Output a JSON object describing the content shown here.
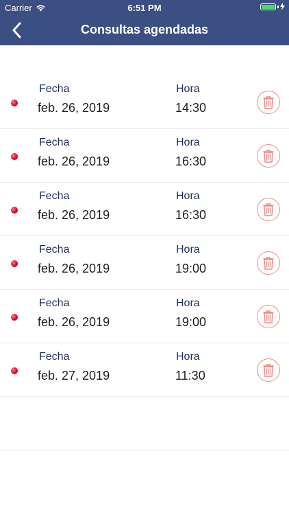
{
  "status_bar": {
    "carrier": "Carrier",
    "time": "6:51 PM"
  },
  "nav": {
    "title": "Consultas agendadas",
    "back_icon": "chevron-left-icon"
  },
  "appointments": [
    {
      "date_label": "Fecha",
      "date": "feb. 26, 2019",
      "time_label": "Hora",
      "time": "14:30"
    },
    {
      "date_label": "Fecha",
      "date": "feb. 26, 2019",
      "time_label": "Hora",
      "time": "16:30"
    },
    {
      "date_label": "Fecha",
      "date": "feb. 26, 2019",
      "time_label": "Hora",
      "time": "16:30"
    },
    {
      "date_label": "Fecha",
      "date": "feb. 26, 2019",
      "time_label": "Hora",
      "time": "19:00"
    },
    {
      "date_label": "Fecha",
      "date": "feb. 26, 2019",
      "time_label": "Hora",
      "time": "19:00"
    },
    {
      "date_label": "Fecha",
      "date": "feb. 27, 2019",
      "time_label": "Hora",
      "time": "11:30"
    }
  ],
  "colors": {
    "header": "#3b4f82",
    "label": "#1f2f5c",
    "delete": "#ef8a84",
    "dot": "#e4002b"
  },
  "icons": {
    "delete": "trash-icon",
    "status": "red-dot-icon"
  }
}
